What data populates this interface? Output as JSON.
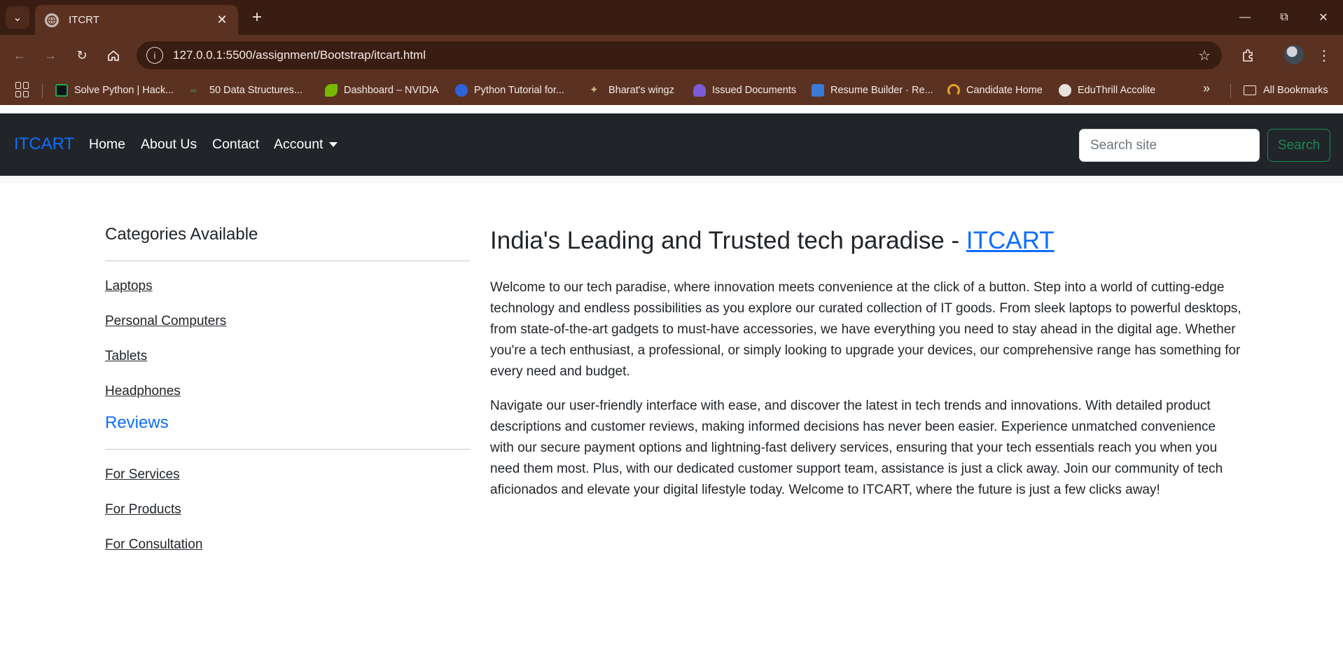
{
  "browser": {
    "tab_title": "ITCRT",
    "url": "127.0.0.1:5500/assignment/Bootstrap/itcart.html",
    "bookmarks": [
      {
        "label": "Solve Python | Hack...",
        "color": "#1ba94c"
      },
      {
        "label": "50 Data Structures...",
        "color": "#2f8d46"
      },
      {
        "label": "Dashboard – NVIDIA",
        "color": "#76b900"
      },
      {
        "label": "Python Tutorial for...",
        "color": "#2d64d8"
      },
      {
        "label": "Bharat's wingz",
        "color": "#c9b38a"
      },
      {
        "label": "Issued Documents",
        "color": "#7b5cd6"
      },
      {
        "label": "Resume Builder · Re...",
        "color": "#3a7bd5"
      },
      {
        "label": "Candidate Home",
        "color": "#e0a526"
      },
      {
        "label": "EduThrill Accolite",
        "color": "#e9e1dc"
      }
    ],
    "all_bookmarks_label": "All Bookmarks"
  },
  "site": {
    "brand": "ITCART",
    "nav": {
      "home": "Home",
      "about": "About Us",
      "contact": "Contact",
      "account": "Account"
    },
    "search": {
      "placeholder": "Search site",
      "button_label": "Search"
    }
  },
  "sidebar": {
    "categories_heading": "Categories Available",
    "categories": [
      "Laptops",
      "Personal Computers",
      "Tablets",
      "Headphones"
    ],
    "reviews_heading": "Reviews",
    "reviews": [
      "For Services",
      "For Products",
      "For Consultation"
    ]
  },
  "main": {
    "heading_prefix": "India's Leading and Trusted tech paradise - ",
    "heading_link": "ITCART",
    "paragraph_1": "Welcome to our tech paradise, where innovation meets convenience at the click of a button. Step into a world of cutting-edge technology and endless possibilities as you explore our curated collection of IT goods. From sleek laptops to powerful desktops, from state-of-the-art gadgets to must-have accessories, we have everything you need to stay ahead in the digital age. Whether you're a tech enthusiast, a professional, or simply looking to upgrade your devices, our comprehensive range has something for every need and budget.",
    "paragraph_2": "Navigate our user-friendly interface with ease, and discover the latest in tech trends and innovations. With detailed product descriptions and customer reviews, making informed decisions has never been easier. Experience unmatched convenience with our secure payment options and lightning-fast delivery services, ensuring that your tech essentials reach you when you need them most. Plus, with our dedicated customer support team, assistance is just a click away. Join our community of tech aficionados and elevate your digital lifestyle today. Welcome to ITCART, where the future is just a few clicks away!"
  },
  "colors": {
    "navbar_bg": "#212529",
    "brand_blue": "#0d6efd",
    "search_green": "#198754",
    "browser_frame": "#3a1d12"
  }
}
